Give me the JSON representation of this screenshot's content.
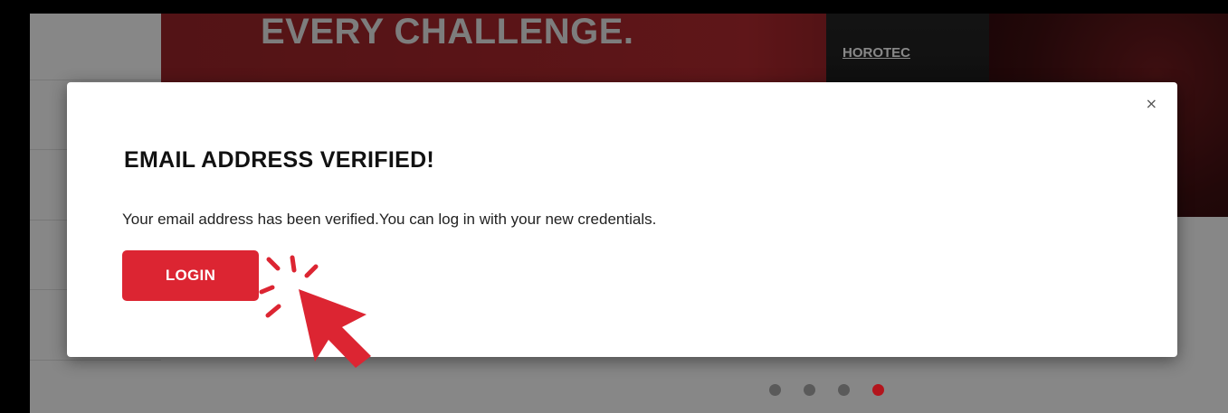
{
  "background_page": {
    "headline": "EVERY CHALLENGE.",
    "brand_logo": "HOROTEC",
    "carousel": {
      "slides": 4,
      "active_index": 3
    }
  },
  "modal": {
    "close_label": "×",
    "title": "EMAIL ADDRESS VERIFIED!",
    "message": "Your email address has been verified.You can log in with your new credentials.",
    "login_button": "LOGIN"
  },
  "annotation": {
    "pointer_icon": "cursor-arrow-icon",
    "color": "#dc2532"
  },
  "colors": {
    "accent": "#dc2532",
    "active_dot": "#b3141c",
    "modal_bg": "#ffffff"
  }
}
